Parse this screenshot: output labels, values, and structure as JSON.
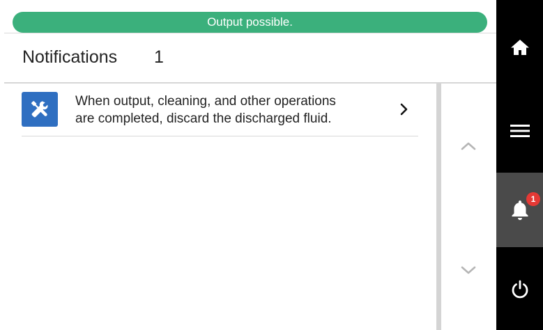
{
  "status": {
    "text": "Output possible.",
    "color": "#3bb07c"
  },
  "header": {
    "title": "Notifications",
    "count": "1"
  },
  "notifications": [
    {
      "icon": "tools-icon",
      "line1": "When output, cleaning, and other operations",
      "line2": "are completed, discard the discharged fluid."
    }
  ],
  "sidebar": {
    "items": [
      {
        "name": "home",
        "icon": "home-icon"
      },
      {
        "name": "menu",
        "icon": "menu-icon"
      },
      {
        "name": "notifications",
        "icon": "bell-icon",
        "badge": "1",
        "active": true
      },
      {
        "name": "power",
        "icon": "power-icon"
      }
    ]
  }
}
